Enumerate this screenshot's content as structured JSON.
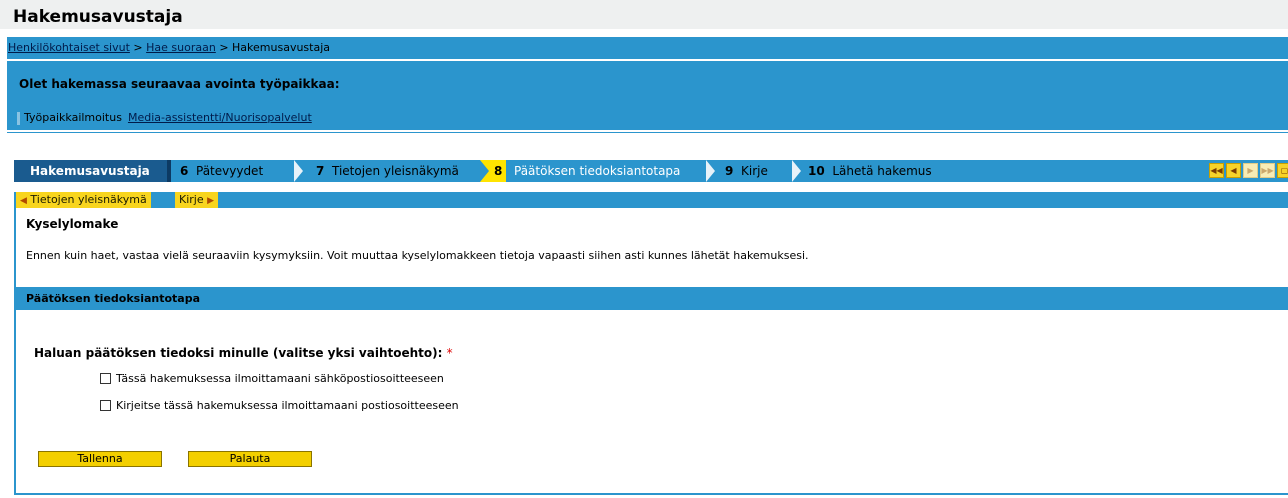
{
  "page": {
    "title": "Hakemusavustaja"
  },
  "breadcrumb": {
    "items": [
      "Henkilökohtaiset sivut",
      "Hae suoraan",
      "Hakemusavustaja"
    ],
    "separator": ">"
  },
  "job": {
    "heading": "Olet hakemassa seuraavaa avointa työpaikkaa:",
    "label": "Työpaikkailmoitus",
    "link": "Media-assistentti/Nuorisopalvelut"
  },
  "tabs": [
    {
      "num": "",
      "label": "Hakemusavustaja",
      "state": "current"
    },
    {
      "num": "6",
      "label": "Pätevyydet",
      "state": "normal"
    },
    {
      "num": "7",
      "label": "Tietojen yleisnäkymä",
      "state": "normal"
    },
    {
      "num": "8",
      "label": "Päätöksen tiedoksiantotapa",
      "state": "active"
    },
    {
      "num": "9",
      "label": "Kirje",
      "state": "normal"
    },
    {
      "num": "10",
      "label": "Lähetä hakemus",
      "state": "normal"
    }
  ],
  "nav_icons": [
    "first-page-icon",
    "previous-page-icon",
    "next-page-icon",
    "last-page-icon",
    "window-icon"
  ],
  "subnav": {
    "prev_label": "Tietojen yleisnäkymä",
    "next_label": "Kirje"
  },
  "form": {
    "title": "Kyselylomake",
    "intro": "Ennen kuin haet, vastaa vielä seuraaviin kysymyksiin. Voit muuttaa kyselylomakkeen tietoja vapaasti siihen asti kunnes lähetät hakemuksesi.",
    "section": "Päätöksen tiedoksiantotapa",
    "question": "Haluan päätöksen tiedoksi minulle (valitse yksi vaihtoehto):",
    "required_mark": "*",
    "options": [
      {
        "label": "Tässä hakemuksessa ilmoittamaani sähköpostiosoitteeseen",
        "checked": false
      },
      {
        "label": "Kirjeitse tässä hakemuksessa ilmoittamaani postiosoitteeseen",
        "checked": false
      }
    ],
    "save_label": "Tallenna",
    "reset_label": "Palauta"
  },
  "colors": {
    "accent": "#2b95cd",
    "current_tab": "#1a5b8f",
    "active_tab": "#ffe400",
    "button": "#f3cf00"
  }
}
